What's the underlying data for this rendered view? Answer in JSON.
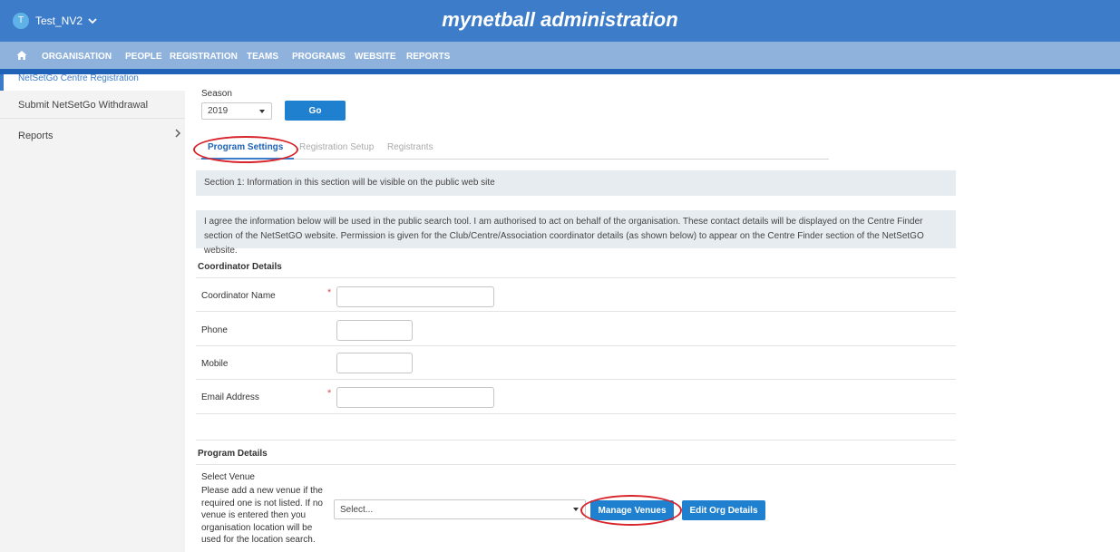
{
  "topbar": {
    "org_initial": "T",
    "org_name": "Test_NV2",
    "brand": "mynetball administration"
  },
  "nav": {
    "items": [
      "ORGANISATION",
      "PEOPLE",
      "REGISTRATION",
      "TEAMS",
      "PROGRAMS",
      "WEBSITE",
      "REPORTS"
    ]
  },
  "sidebar": {
    "items": [
      "NetSetGo Centre Registration",
      "Submit NetSetGo Withdrawal",
      "Reports"
    ]
  },
  "season": {
    "label": "Season",
    "value": "2019",
    "go_label": "Go"
  },
  "tabs": [
    "Program Settings",
    "Registration Setup",
    "Registrants"
  ],
  "section1": {
    "notice": "Section 1: Information in this section will be visible on the public web site",
    "consent": "I agree the information below will be used in the public search tool. I am authorised to act on behalf of the organisation. These contact details will be displayed on the Centre Finder section of the NetSetGO website. Permission is given for the Club/Centre/Association coordinator details (as shown below) to appear on the Centre Finder section of the NetSetGO website."
  },
  "coordinator": {
    "heading": "Coordinator Details",
    "fields": [
      {
        "label": "Coordinator Name",
        "value": "",
        "required": "*"
      },
      {
        "label": "Phone",
        "value": ""
      },
      {
        "label": "Mobile",
        "value": ""
      },
      {
        "label": "Email Address",
        "value": "",
        "required": "*"
      }
    ]
  },
  "program": {
    "heading": "Program Details",
    "venue_label": "Select Venue",
    "venue_help": "Please add a new venue if the required one is not listed. If no venue is entered then you organisation location will be used for the location search.",
    "venue_placeholder": "Select...",
    "manage_venues_label": "Manage Venues",
    "edit_org_label": "Edit Org Details"
  },
  "colors": {
    "topbar": "#3d7cc9",
    "navbar": "#8fb2dd",
    "button": "#1f80d0",
    "annotation": "#d8252b"
  }
}
